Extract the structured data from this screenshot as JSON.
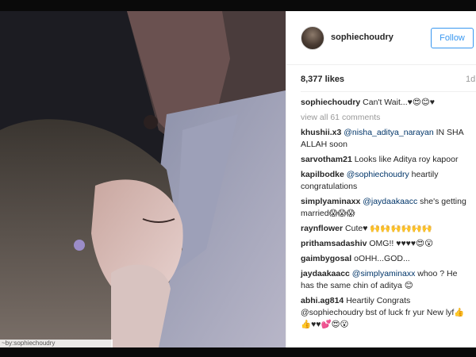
{
  "post": {
    "username": "sophiechoudry",
    "follow_label": "Follow",
    "likes": "8,377 likes",
    "age": "1d",
    "view_all": "view all 61 comments",
    "watermark": "~by:sophiechoudry"
  },
  "comments": [
    {
      "user": "sophiechoudry",
      "mention": "",
      "text": " Can't Wait...♥😍😊♥"
    },
    {
      "user": "khushii.x3",
      "mention": " @nisha_aditya_narayan",
      "text": " IN SHA ALLAH soon"
    },
    {
      "user": "sarvotham21",
      "mention": "",
      "text": " Looks like Aditya roy kapoor"
    },
    {
      "user": "kapilbodke",
      "mention": " @sophiechoudry",
      "text": " heartily congratulations"
    },
    {
      "user": "simplyaminaxx",
      "mention": " @jaydaakaacc",
      "text": " she's getting married😱😱😱"
    },
    {
      "user": "raynflower",
      "mention": "",
      "text": " Cute♥ 🙌🙌🙌🙌🙌🙌"
    },
    {
      "user": "prithamsadashiv",
      "mention": "",
      "text": " OMG!! ♥♥♥♥😍😮"
    },
    {
      "user": "gaimbygosal",
      "mention": "",
      "text": " oOHH...GOD..."
    },
    {
      "user": "jaydaakaacc",
      "mention": " @simplyaminaxx",
      "text": " whoo ? He has the same chin of aditya 😊"
    },
    {
      "user": "abhi.ag814",
      "mention": "",
      "text": " Heartily Congrats @sophiechoudry bst of luck fr yur New lyf👍👍♥♥💕😍😮"
    }
  ]
}
